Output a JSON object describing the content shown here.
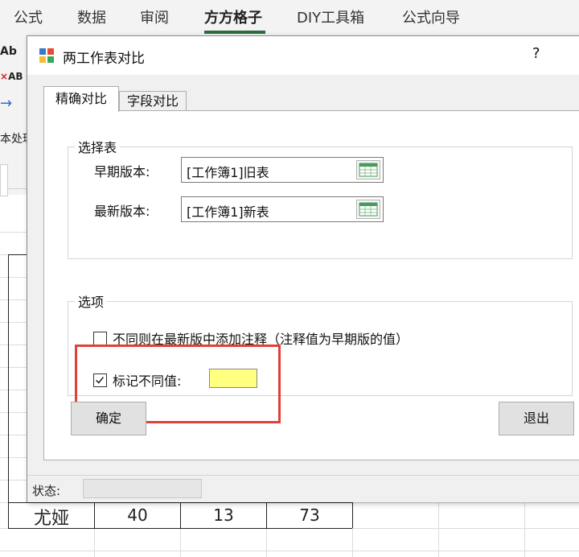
{
  "ribbon": {
    "tabs": [
      "公式",
      "数据",
      "审阅",
      "方方格子",
      "DIY工具箱",
      "公式向导"
    ],
    "active_tab": "方方格子"
  },
  "ribbon_left": {
    "item1": "Ab",
    "item2": "AB",
    "item3": "→",
    "item4": "本处理"
  },
  "sheet": {
    "rows": [
      {
        "name": "尤娅",
        "c1": "40",
        "c2": "13",
        "c3": "73"
      }
    ]
  },
  "dialog": {
    "title": "两工作表对比",
    "help": "?",
    "tabs": [
      "精确对比",
      "字段对比"
    ],
    "select_group": {
      "label": "选择表",
      "early_label": "早期版本:",
      "early_value": "[工作簿1]旧表",
      "latest_label": "最新版本:",
      "latest_value": "[工作簿1]新表"
    },
    "options_group": {
      "label": "选项",
      "opt1_label": "不同则在最新版中添加注释（注释值为早期版的值）",
      "opt1_checked": false,
      "opt2_label": "标记不同值:",
      "opt2_checked": true,
      "mark_color": "#ffff80"
    },
    "ok": "确定",
    "exit": "退出",
    "status_label": "状态:"
  }
}
